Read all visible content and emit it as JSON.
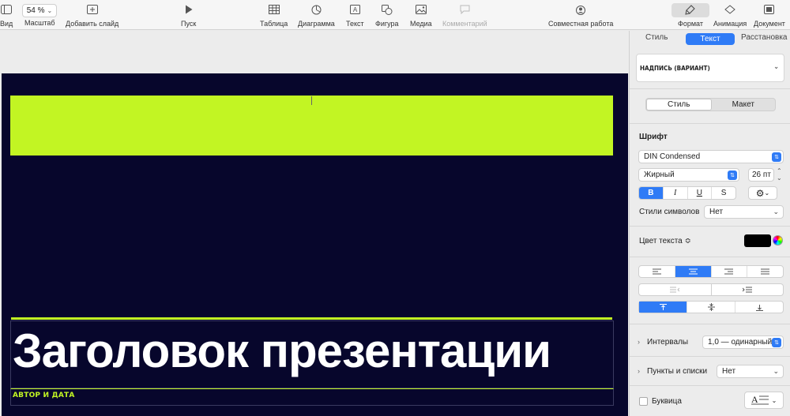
{
  "toolbar": {
    "view_label": "Вид",
    "zoom_value": "54 %",
    "zoom_label": "Масштаб",
    "add_slide_label": "Добавить слайд",
    "play_label": "Пуск",
    "table_label": "Таблица",
    "chart_label": "Диаграмма",
    "text_label": "Текст",
    "shape_label": "Фигура",
    "media_label": "Медиа",
    "comment_label": "Комментарий",
    "collab_label": "Совместная работа",
    "format_label": "Формат",
    "animate_label": "Анимация",
    "document_label": "Документ"
  },
  "slide": {
    "title": "Заголовок презентации",
    "subtitle": "АВТОР И ДАТА",
    "accent_color": "#c2f523",
    "background_color": "#07062c"
  },
  "inspector": {
    "tabs": [
      "Стиль",
      "Текст",
      "Расстановка"
    ],
    "active_tab": "Текст",
    "paragraph_style": "НАДПИСЬ (ВАРИАНТ)",
    "style_layout": [
      "Стиль",
      "Макет"
    ],
    "font_section": "Шрифт",
    "font_family": "DIN Condensed",
    "font_typeface": "Жирный",
    "font_size": "26 пт",
    "bius": [
      "B",
      "I",
      "U",
      "S"
    ],
    "char_styles_label": "Стили символов",
    "char_styles_value": "Нет",
    "text_color_label": "Цвет текста ≎",
    "spacing_label": "Интервалы",
    "spacing_value": "1,0 — одинарный",
    "bullets_label": "Пункты и списки",
    "bullets_value": "Нет",
    "dropcap_label": "Буквица"
  }
}
